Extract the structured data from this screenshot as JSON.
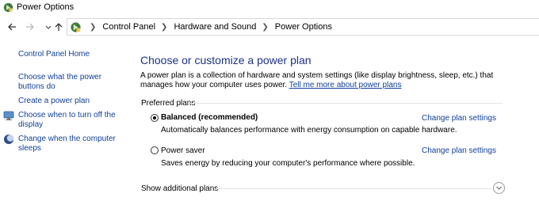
{
  "window": {
    "title": "Power Options"
  },
  "navigation": {
    "back_icon": "arrow-left-icon",
    "forward_icon": "arrow-right-icon",
    "recent_icon": "chevron-down-icon",
    "up_icon": "arrow-up-icon",
    "breadcrumbs": [
      {
        "label": "Control Panel"
      },
      {
        "label": "Hardware and Sound"
      },
      {
        "label": "Power Options"
      }
    ]
  },
  "sidebar": {
    "home": "Control Panel Home",
    "items": [
      {
        "label": "Choose what the power buttons do",
        "icon": null
      },
      {
        "label": "Create a power plan",
        "icon": null
      },
      {
        "label": "Choose when to turn off the display",
        "icon": "monitor-icon"
      },
      {
        "label": "Change when the computer sleeps",
        "icon": "moon-icon"
      }
    ]
  },
  "main": {
    "heading": "Choose or customize a power plan",
    "description": "A power plan is a collection of hardware and system settings (like display brightness, sleep, etc.) that manages how your computer uses power. ",
    "description_link": "Tell me more about power plans",
    "preferred_label": "Preferred plans",
    "plans": [
      {
        "name": "Balanced (recommended)",
        "description": "Automatically balances performance with energy consumption on capable hardware.",
        "action": "Change plan settings",
        "selected": true
      },
      {
        "name": "Power saver",
        "description": "Saves energy by reducing your computer's performance where possible.",
        "action": "Change plan settings",
        "selected": false
      }
    ],
    "additional_label": "Show additional plans"
  }
}
